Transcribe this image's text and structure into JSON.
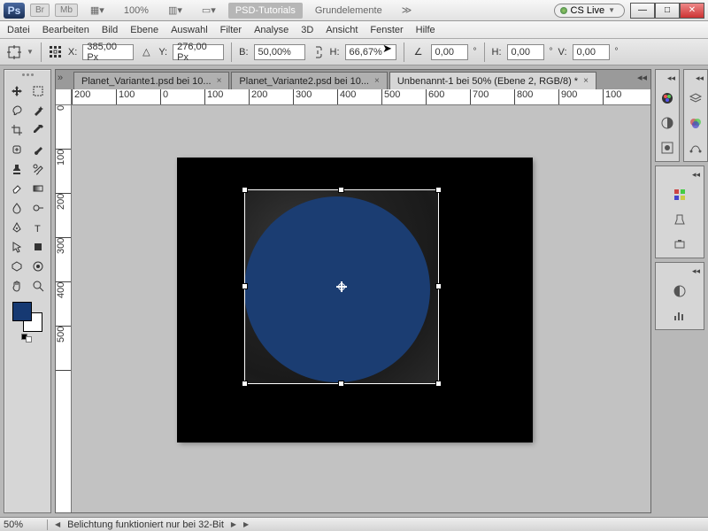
{
  "title": {
    "ps": "Ps",
    "br": "Br",
    "mb": "Mb",
    "zoom": "100%",
    "tutorials": "PSD-Tutorials",
    "grund": "Grundelemente",
    "cslive": "CS Live"
  },
  "menu": [
    "Datei",
    "Bearbeiten",
    "Bild",
    "Ebene",
    "Auswahl",
    "Filter",
    "Analyse",
    "3D",
    "Ansicht",
    "Fenster",
    "Hilfe"
  ],
  "opt": {
    "xlabel": "X:",
    "x": "385,00 Px",
    "ylabel": "Y:",
    "y": "276,00 Px",
    "wlabel": "B:",
    "w": "50,00%",
    "hlabel": "H:",
    "h": "66,67%",
    "anglelabel": "",
    "angle": "0,00",
    "h2label": "H:",
    "h2": "0,00",
    "vlabel": "V:",
    "v": "0,00",
    "deg": "°"
  },
  "tabs": [
    {
      "label": "Planet_Variante1.psd bei 10...",
      "active": false
    },
    {
      "label": "Planet_Variante2.psd bei 10...",
      "active": false
    },
    {
      "label": "Unbenannt-1 bei 50% (Ebene 2, RGB/8) *",
      "active": true
    }
  ],
  "hruler": [
    "200",
    "100",
    "0",
    "100",
    "200",
    "300",
    "400",
    "500",
    "600",
    "700",
    "800",
    "900",
    "100"
  ],
  "vruler": [
    "0",
    "100",
    "200",
    "300",
    "400",
    "500"
  ],
  "status": {
    "zoom": "50%",
    "msg": "Belichtung funktioniert nur bei 32-Bit"
  },
  "colors": {
    "foreground": "#163972"
  }
}
